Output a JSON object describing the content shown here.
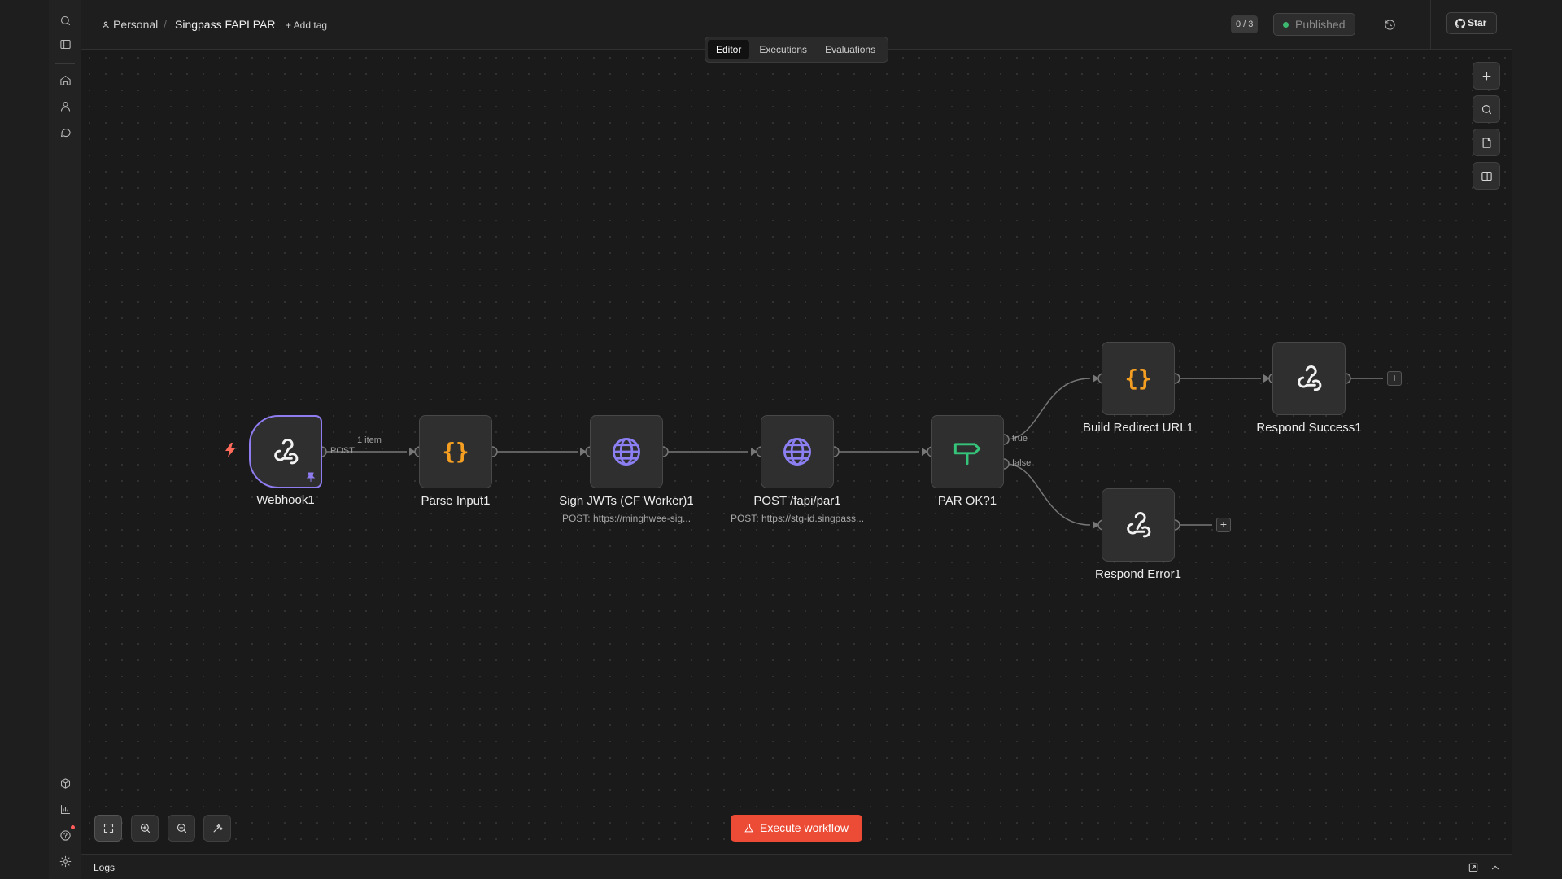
{
  "header": {
    "project": "Personal",
    "separator": "/",
    "workflow_name": "Singpass FAPI PAR",
    "add_tag": "+ Add tag",
    "counter": "0 / 3",
    "status": "Published",
    "star": "Star"
  },
  "tabs": [
    {
      "label": "Editor",
      "active": true
    },
    {
      "label": "Executions",
      "active": false
    },
    {
      "label": "Evaluations",
      "active": false
    }
  ],
  "nodes": {
    "webhook": {
      "label": "Webhook1"
    },
    "parse": {
      "label": "Parse Input1"
    },
    "sign": {
      "label": "Sign JWTs (CF Worker)1",
      "subtitle": "POST: https://minghwee-sig..."
    },
    "post": {
      "label": "POST /fapi/par1",
      "subtitle": "POST: https://stg-id.singpass..."
    },
    "if": {
      "label": "PAR OK?1"
    },
    "build": {
      "label": "Build Redirect URL1"
    },
    "success": {
      "label": "Respond Success1"
    },
    "error": {
      "label": "Respond Error1"
    }
  },
  "edges": {
    "method": "POST",
    "items": "1 item",
    "true_label": "true",
    "false_label": "false"
  },
  "footer": {
    "execute": "Execute workflow",
    "logs": "Logs"
  },
  "colors": {
    "accent": "#ec4b36",
    "trigger_border": "#8f7cf0",
    "code_icon": "#f59f22",
    "http_icon": "#8b7ff2",
    "if_icon": "#35c47a",
    "published_dot": "#3db870"
  }
}
